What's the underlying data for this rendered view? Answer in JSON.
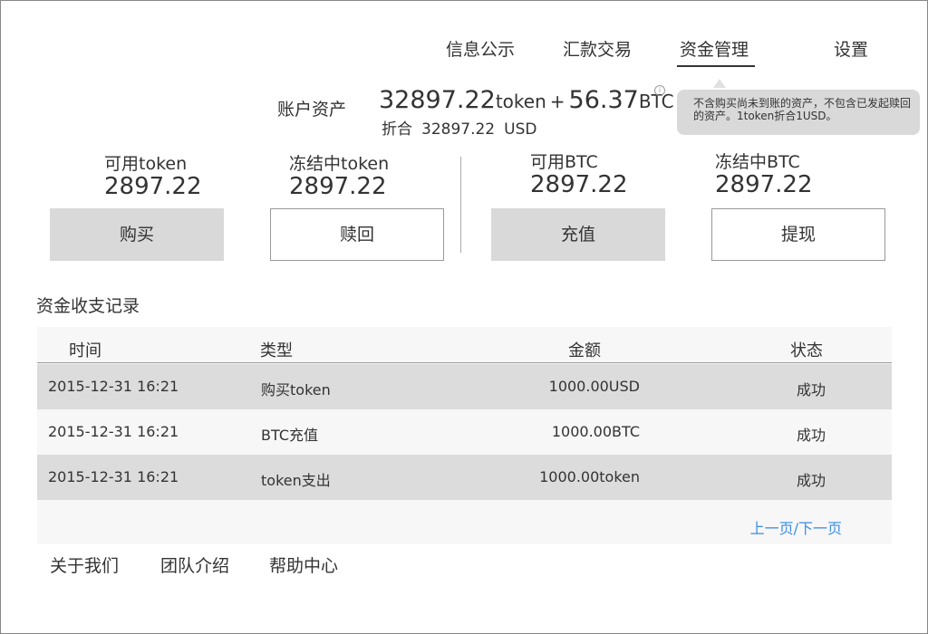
{
  "nav": {
    "items": [
      {
        "label": "信息公示"
      },
      {
        "label": "汇款交易"
      },
      {
        "label": "资金管理"
      },
      {
        "label": "设置"
      }
    ],
    "active": "资金管理"
  },
  "assets": {
    "label": "账户资产",
    "token_amount": "32897.22",
    "token_unit": "token",
    "plus": "+",
    "btc_amount": "56.37",
    "btc_unit": "BTC",
    "equiv_label": "折合",
    "equiv_amount": "32897.22",
    "equiv_unit": "USD",
    "info_icon": "i",
    "tooltip": "不含购买尚未到账的资产，不包含已发起赎回的资产。1token折合1USD。"
  },
  "balances": [
    {
      "label": "可用token",
      "value": "2897.22"
    },
    {
      "label": "冻结中token",
      "value": "2897.22"
    },
    {
      "label": "可用BTC",
      "value": "2897.22"
    },
    {
      "label": "冻结中BTC",
      "value": "2897.22"
    }
  ],
  "actions": {
    "buy": "购买",
    "redeem": "赎回",
    "deposit": "充值",
    "withdraw": "提现"
  },
  "records": {
    "title": "资金收支记录",
    "columns": [
      "时间",
      "类型",
      "金额",
      "状态"
    ],
    "rows": [
      {
        "time": "2015-12-31 16:21",
        "type": "购买token",
        "amount": "1000.00USD",
        "status": "成功"
      },
      {
        "time": "2015-12-31 16:21",
        "type": "BTC充值",
        "amount": "1000.00BTC",
        "status": "成功"
      },
      {
        "time": "2015-12-31 16:21",
        "type": "token支出",
        "amount": "1000.00token",
        "status": "成功"
      }
    ],
    "pager": "上一页/下一页"
  },
  "footer": {
    "links": [
      "关于我们",
      "团队介绍",
      "帮助中心"
    ]
  }
}
